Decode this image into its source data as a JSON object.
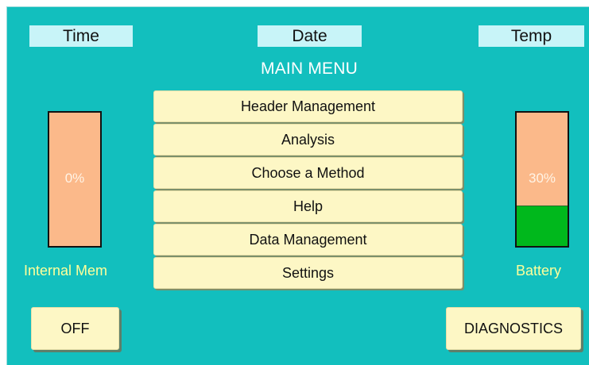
{
  "status_bar": {
    "time_label": "Time",
    "date_label": "Date",
    "temp_label": "Temp"
  },
  "menu": {
    "title": "MAIN MENU",
    "items": [
      {
        "label": "Header Management"
      },
      {
        "label": "Analysis"
      },
      {
        "label": "Choose a Method"
      },
      {
        "label": "Help"
      },
      {
        "label": "Data Management"
      },
      {
        "label": "Settings"
      }
    ]
  },
  "internal_memory": {
    "label": "Internal Mem",
    "value_text": "0%",
    "level": 0
  },
  "battery": {
    "label": "Battery",
    "value_text": "30%",
    "level": 0.3
  },
  "buttons": {
    "off_label": "OFF",
    "diagnostics_label": "DIAGNOSTICS"
  },
  "colors": {
    "background": "#12bfbe",
    "button_fill": "#fdf7c5",
    "status_box": "#c8f4f8",
    "gauge_empty": "#fbb98a",
    "gauge_fill": "#00b81c",
    "gauge_label": "#ffff9a"
  }
}
